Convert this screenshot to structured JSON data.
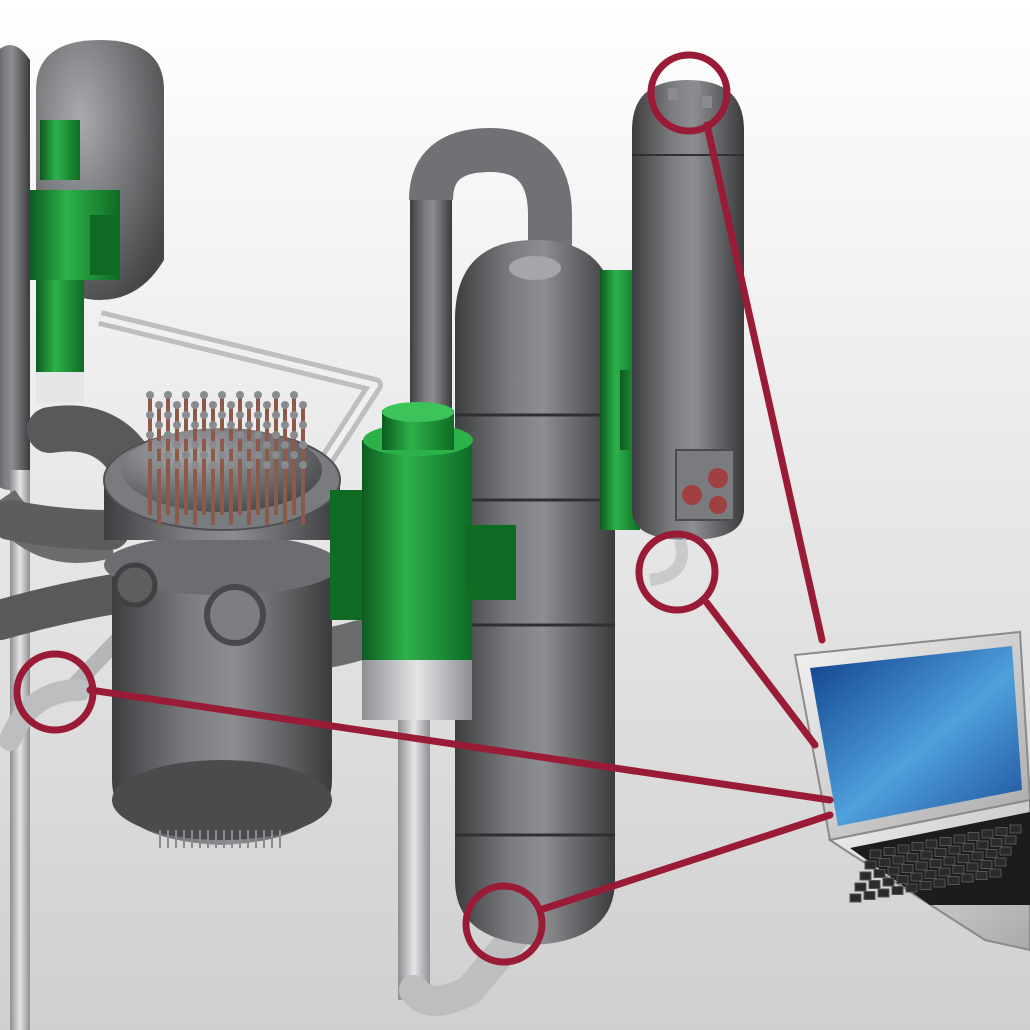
{
  "scene": {
    "subject": "reactor-coolant-system-3d-model",
    "colors": {
      "background_top": "#ffffff",
      "background_bottom": "#cfcfcf",
      "steel": "#5e5f61",
      "steel_light": "#8a8b8e",
      "steel_dark": "#3d3e40",
      "pump_green": "#1f9a3a",
      "pipe_light": "#c9cacc",
      "callout": "#9a1b36",
      "nozzle_copper": "#8b5a4a",
      "screen_blue": "#2f74b8"
    },
    "callouts": [
      {
        "target": "pressurizer-top-head"
      },
      {
        "target": "pressurizer-surge-line"
      },
      {
        "target": "cold-leg-pipe"
      },
      {
        "target": "steam-generator-bottom-head"
      }
    ],
    "monitor": {
      "icon": "laptop-icon"
    }
  }
}
